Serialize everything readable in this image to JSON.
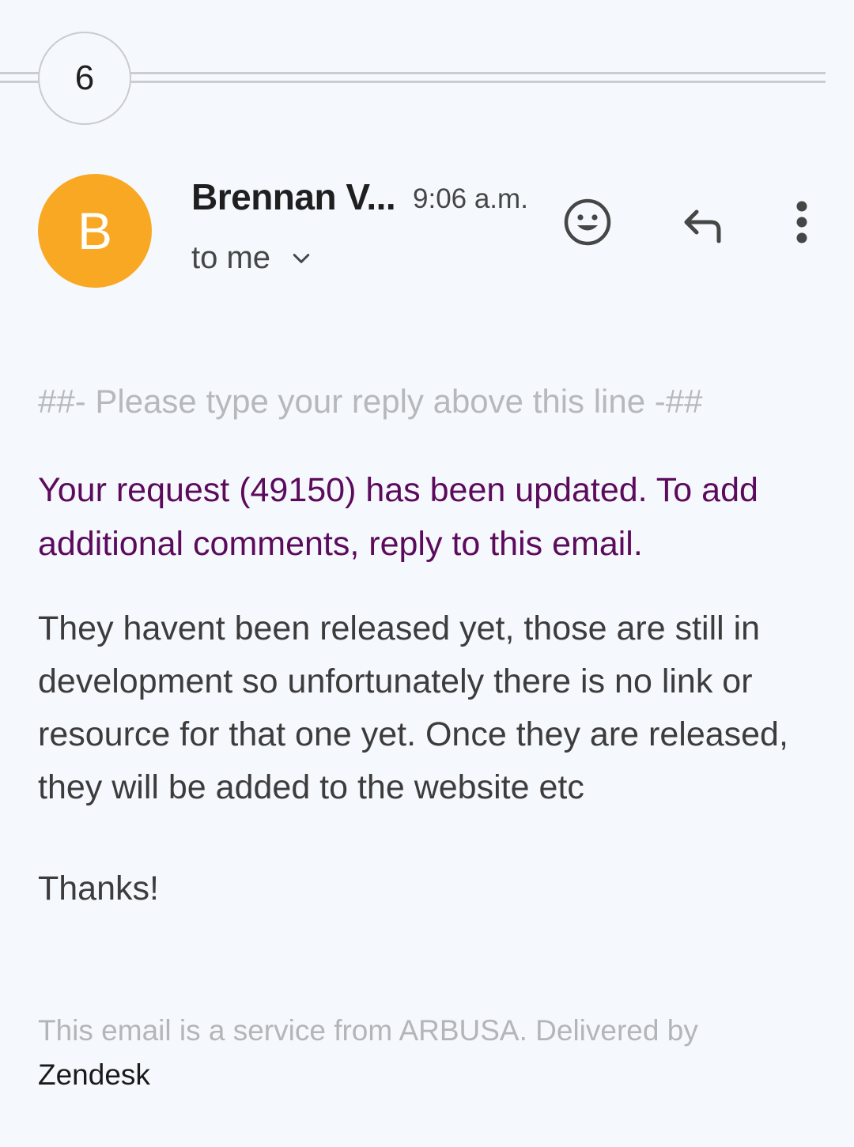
{
  "thread": {
    "collapsed_count": "6"
  },
  "header": {
    "avatar_letter": "B",
    "avatar_color": "#f8a823",
    "sender_name": "Brennan V...",
    "time": "9:06 a.m.",
    "recipient_label": "to me",
    "actions": {
      "emoji_icon": "emoji-reaction-icon",
      "reply_icon": "reply-icon",
      "more_icon": "more-vert-icon"
    }
  },
  "body": {
    "reply_marker": "##- Please type your reply above this line -##",
    "update_notice": "Your request (49150) has been updated. To add additional comments, reply to this email.",
    "update_notice_color": "#5c0a5c",
    "message": "They havent been released yet, those are still in development so unfortunately there is no link or resource for that one yet. Once they are released, they will be added to the website etc",
    "sign_off": "Thanks!"
  },
  "footer": {
    "service_text": "This email is a service from ARBUSA. Delivered by",
    "provider_link": "Zendesk"
  }
}
